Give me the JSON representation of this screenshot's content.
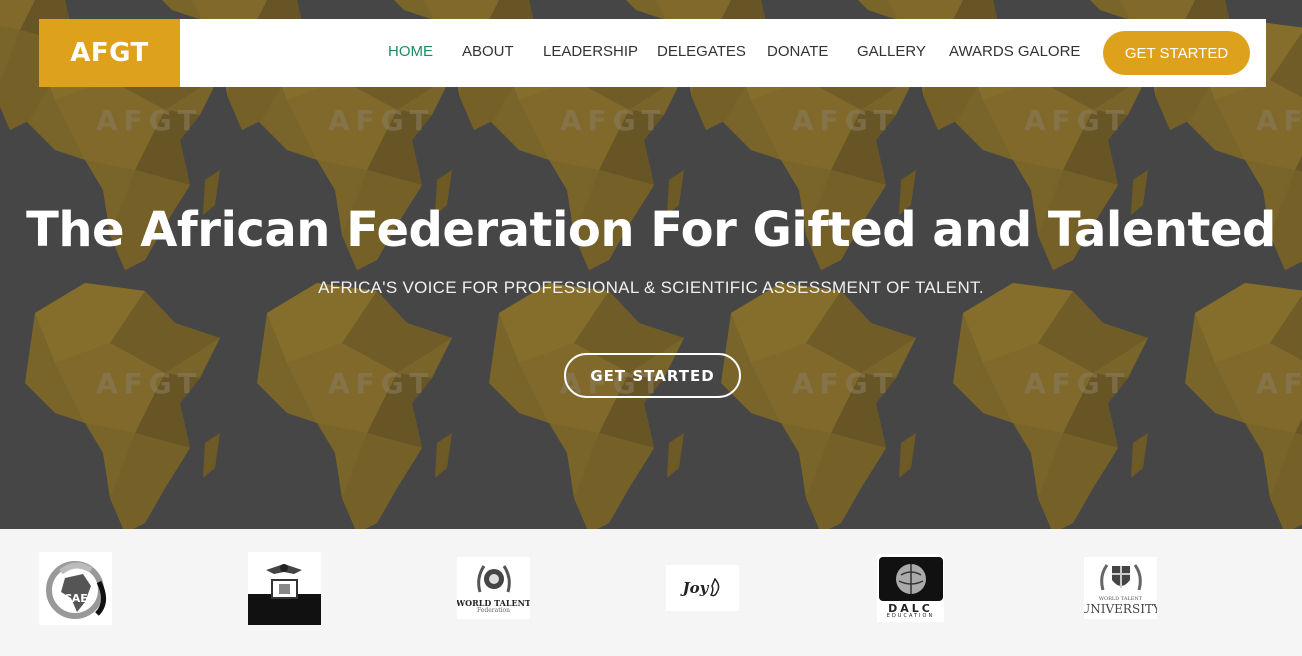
{
  "brand": {
    "logo_text": "AFGT",
    "accent_color": "#dea11c",
    "active_color": "#1f8b61"
  },
  "nav": {
    "items": [
      {
        "label": "HOME",
        "active": true
      },
      {
        "label": "ABOUT",
        "active": false
      },
      {
        "label": "LEADERSHIP",
        "active": false
      },
      {
        "label": "DELEGATES",
        "active": false
      },
      {
        "label": "DONATE",
        "active": false
      },
      {
        "label": "GALLERY",
        "active": false
      },
      {
        "label": "AWARDS GALORE",
        "active": false
      }
    ],
    "cta_label": "GET STARTED"
  },
  "hero": {
    "background_watermark": "AFGT",
    "title": "The African Federation For Gifted and Talented",
    "subtitle": "AFRICA'S VOICE FOR PROFESSIONAL & SCIENTIFIC ASSESSMENT OF TALENT.",
    "button_label": "GET STARTED"
  },
  "partners": [
    {
      "name": "acael-logo",
      "text": "ACAEL"
    },
    {
      "name": "eagle-crest-logo",
      "text": ""
    },
    {
      "name": "world-talent-federation-logo",
      "text": "WORLD TALENT",
      "subtext": "Federation"
    },
    {
      "name": "joy-logo",
      "text": "Joy"
    },
    {
      "name": "dalc-education-logo",
      "text": "DALC",
      "subtext": "EDUCATION"
    },
    {
      "name": "world-talent-university-logo",
      "text": "UNIVERSITY",
      "subtext": "WORLD TALENT"
    }
  ]
}
